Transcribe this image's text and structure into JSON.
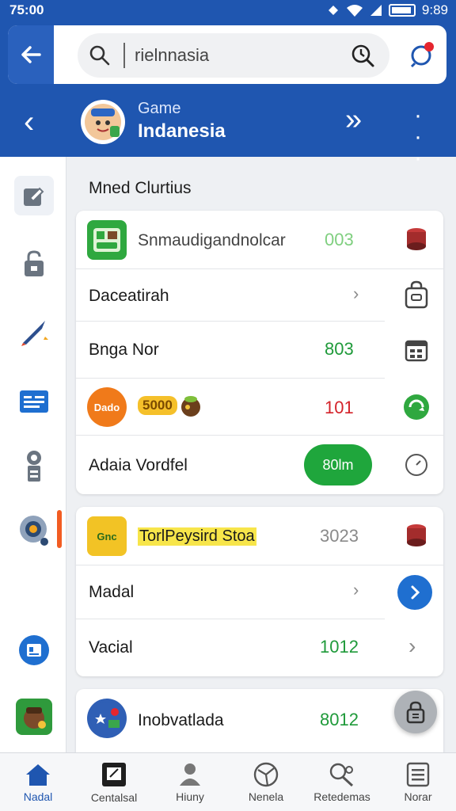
{
  "status": {
    "time": "75:00",
    "clock_right": "9:89"
  },
  "search": {
    "value": "rielnnasia"
  },
  "header": {
    "subtitle": "Game",
    "title": "Indanesia"
  },
  "section": {
    "title": "Mned Clurtius"
  },
  "card1": {
    "rows": [
      {
        "label": "Snmaudigandnolcar",
        "value": "003",
        "value_color": "#7fcf7f"
      },
      {
        "label": "Daceatirah"
      },
      {
        "label": "Bnga Nor",
        "value": "803",
        "value_color": "#1f9a3a"
      },
      {
        "icon_text": "Dado",
        "extra": "5000",
        "value": "101",
        "value_color": "#d4232a"
      },
      {
        "label": "Adaia Vordfel",
        "pill": "80lm"
      }
    ]
  },
  "card2": {
    "rows": [
      {
        "label": "TorlPeysird Stoa",
        "value": "3023",
        "value_color": "#8a8a8a",
        "icon_text": "Gnc"
      },
      {
        "label": "Madal"
      },
      {
        "label": "Vacial",
        "value": "1012",
        "value_color": "#1f9a3a"
      }
    ]
  },
  "card3": {
    "rows": [
      {
        "label": "Inobvatlada",
        "value": "8012",
        "value_color": "#1f9a3a"
      }
    ]
  },
  "bottom_nav": [
    {
      "label": "Nadal",
      "icon": "home-icon",
      "active": true
    },
    {
      "label": "Centalsal",
      "icon": "tablet-icon"
    },
    {
      "label": "Hiuny",
      "icon": "person-icon"
    },
    {
      "label": "Nenela",
      "icon": "ball-icon"
    },
    {
      "label": "Retedemas",
      "icon": "search-person-icon"
    },
    {
      "label": "Norar",
      "icon": "list-icon"
    }
  ],
  "colors": {
    "primary": "#1f56b0",
    "green": "#1fa63c",
    "orange": "#f25c22"
  }
}
